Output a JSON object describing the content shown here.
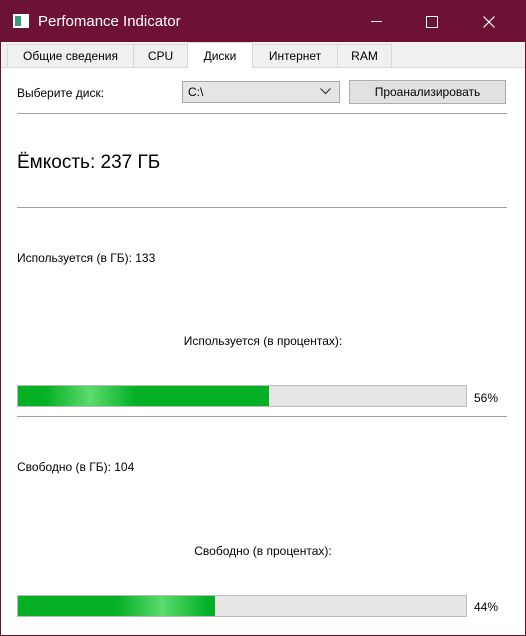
{
  "window": {
    "title": "Perfomance Indicator"
  },
  "tabs": [
    {
      "label": "Общие сведения",
      "active": false
    },
    {
      "label": "CPU",
      "active": false
    },
    {
      "label": "Диски",
      "active": true
    },
    {
      "label": "Интернет",
      "active": false
    },
    {
      "label": "RAM",
      "active": false
    }
  ],
  "disk_panel": {
    "select_label": "Выберите диск:",
    "selected_disk": "C:\\",
    "analyze_button": "Проанализировать",
    "capacity_text": "Ёмкость: 237 ГБ",
    "used_gb_text": "Используется (в ГБ): 133",
    "used_percent_label": "Используется (в процентах):",
    "used_percent": 56,
    "used_percent_text": "56%",
    "free_gb_text": "Свободно (в ГБ): 104",
    "free_percent_label": "Свободно (в процентах):",
    "free_percent": 44,
    "free_percent_text": "44%"
  },
  "colors": {
    "titlebar": "#6d1135",
    "progress_fill": "#06b025",
    "progress_track": "#e6e6e6"
  },
  "icons": [
    "app-icon",
    "chevron-down-icon",
    "minimize-icon",
    "maximize-icon",
    "close-icon"
  ]
}
